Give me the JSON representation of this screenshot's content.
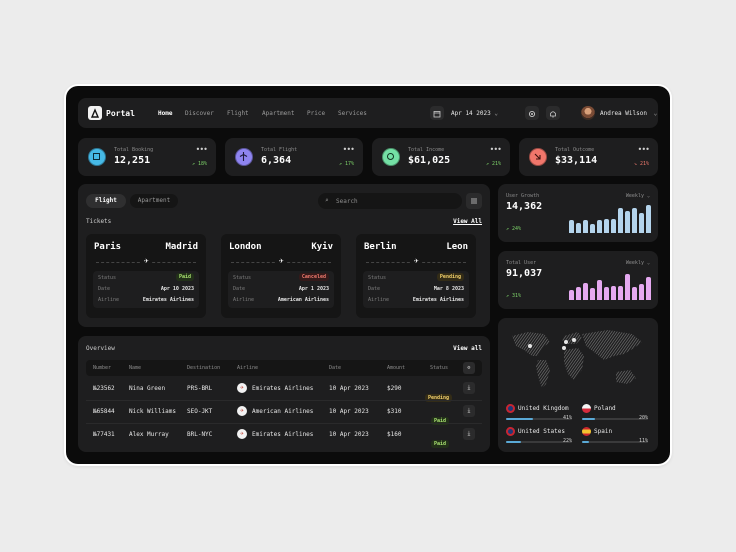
{
  "nav": {
    "brand": "Portal",
    "links": [
      "Home",
      "Discover",
      "Flight",
      "Apartment",
      "Price",
      "Services"
    ],
    "date": "Apr 14 2023",
    "user": "Andrea Wilson"
  },
  "stats": [
    {
      "label": "Total Booking",
      "value": "12,251",
      "trend": "18%",
      "color": "#46b9e6",
      "trend_color": "#7ed46a"
    },
    {
      "label": "Total Flight",
      "value": "6,364",
      "trend": "17%",
      "color": "#8e84f0",
      "trend_color": "#7ed46a"
    },
    {
      "label": "Total Income",
      "value": "$61,025",
      "trend": "21%",
      "color": "#74e0a5",
      "trend_color": "#7ed46a"
    },
    {
      "label": "Total Outcome",
      "value": "$33,114",
      "trend": "21%",
      "color": "#f0766b",
      "trend_color": "#f07a6e"
    }
  ],
  "flights": {
    "tab_active": "Flight",
    "tab_other": "Apartment",
    "search_placeholder": "Search",
    "section_title": "Tickets",
    "view_all": "View All",
    "tickets": [
      {
        "from": "Paris",
        "to": "Madrid",
        "status": "Paid",
        "date": "Apr 10 2023",
        "airline": "Emirates Airlines"
      },
      {
        "from": "London",
        "to": "Kyiv",
        "status": "Canceled",
        "date": "Apr 1 2023",
        "airline": "American Airlines"
      },
      {
        "from": "Berlin",
        "to": "Leon",
        "status": "Pending",
        "date": "Mar 8 2023",
        "airline": "Emirates Airlines"
      }
    ],
    "labels": {
      "status": "Status",
      "date": "Date",
      "airline": "Airline"
    }
  },
  "overview": {
    "title": "Overview",
    "view_all": "View all",
    "headers": [
      "Number",
      "Name",
      "Destination",
      "Airline",
      "Date",
      "Amount",
      "Status"
    ],
    "rows": [
      {
        "number": "№23562",
        "name": "Nina Green",
        "dest": "PRS-BRL",
        "airline": "Emirates Airlines",
        "date": "10 Apr 2023",
        "amount": "$290",
        "status": "Pending"
      },
      {
        "number": "№65844",
        "name": "Nick Williams",
        "dest": "SEO-JKT",
        "airline": "American Airlines",
        "date": "10 Apr 2023",
        "amount": "$310",
        "status": "Paid"
      },
      {
        "number": "№77431",
        "name": "Alex Murray",
        "dest": "BRL-NYC",
        "airline": "Emirates Airlines",
        "date": "10 Apr 2023",
        "amount": "$160",
        "status": "Paid"
      }
    ]
  },
  "growth": {
    "label": "User Growth",
    "value": "14,362",
    "period": "Weekly",
    "trend": "24%",
    "bars": [
      0.45,
      0.35,
      0.45,
      0.3,
      0.45,
      0.5,
      0.5,
      0.85,
      0.75,
      0.85,
      0.7,
      0.95
    ],
    "color": "#b4d4ec"
  },
  "total_user": {
    "label": "Total User",
    "value": "91,037",
    "period": "Weekly",
    "trend": "31%",
    "bars": [
      0.35,
      0.45,
      0.6,
      0.4,
      0.7,
      0.45,
      0.5,
      0.5,
      0.9,
      0.45,
      0.55,
      0.8
    ],
    "color": "#e5a9f0"
  },
  "map": {
    "countries": [
      {
        "name": "United Kingdom",
        "pct": "41%",
        "value": 0.41,
        "flag": "uk"
      },
      {
        "name": "Poland",
        "pct": "20%",
        "value": 0.2,
        "flag": "pl"
      },
      {
        "name": "United States",
        "pct": "22%",
        "value": 0.22,
        "flag": "us"
      },
      {
        "name": "Spain",
        "pct": "11%",
        "value": 0.11,
        "flag": "es"
      }
    ]
  }
}
